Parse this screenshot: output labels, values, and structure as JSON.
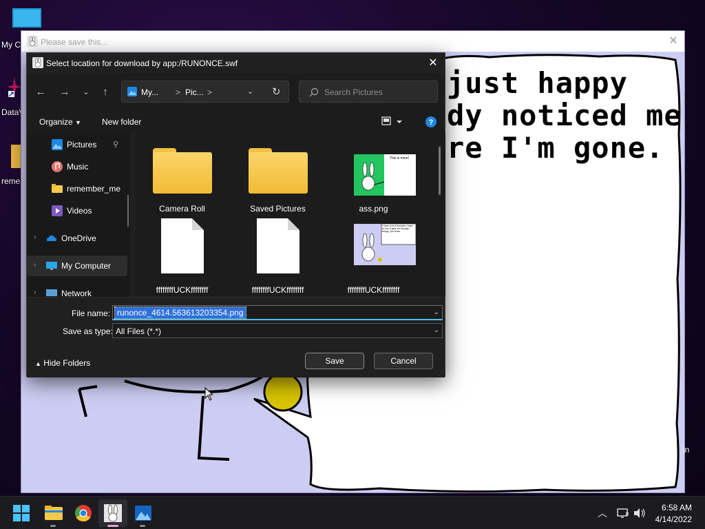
{
  "desktop": {
    "icons": [
      {
        "label": "My C"
      },
      {
        "label": "DataV"
      },
      {
        "label": "reme"
      }
    ],
    "side_text": "in"
  },
  "app_window": {
    "title": "Please save this...",
    "speech_lines": [
      "just happy",
      "dy noticed me",
      "re I'm gone."
    ]
  },
  "dialog": {
    "title": "Select location for download by app:/RUNONCE.swf",
    "address": {
      "seg1": "My...",
      "sep": ">",
      "seg2": "Pic...",
      "sep2": ">"
    },
    "search_placeholder": "Search Pictures",
    "commands": {
      "organize": "Organize",
      "new_folder": "New folder"
    },
    "nav_items": [
      {
        "label": "Pictures"
      },
      {
        "label": "Music"
      },
      {
        "label": "remember_me"
      },
      {
        "label": "Videos"
      },
      {
        "label": "OneDrive"
      },
      {
        "label": "My Computer"
      },
      {
        "label": "Network"
      }
    ],
    "files": [
      {
        "label": "Camera Roll"
      },
      {
        "label": "Saved Pictures"
      },
      {
        "label": "ass.png",
        "thumb_text": "This is mine!"
      },
      {
        "label": "ffffffffUCKffffffff"
      },
      {
        "label": "ffffffffUCKffffffff"
      },
      {
        "label": "ffffffffUCKffffffff",
        "thumb_text": "I have a lot of bunnies. Hope is how it gets me through things, you know."
      }
    ],
    "file_name_label": "File name:",
    "file_name_value": "runonce_4614.563613203354.png",
    "save_type_label": "Save as type:",
    "save_type_value": "All Files (*.*)",
    "hide_folders": "Hide Folders",
    "save_label": "Save",
    "cancel_label": "Cancel"
  },
  "taskbar": {
    "time": "6:58 AM",
    "date": "4/14/2022"
  },
  "colors": {
    "accent": "#4cc2ff",
    "selection": "#2f6fdc",
    "folder": "#f7c948"
  }
}
